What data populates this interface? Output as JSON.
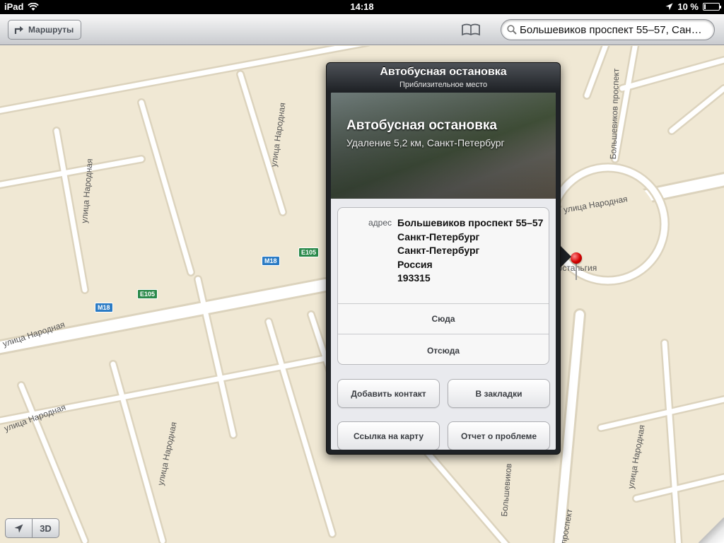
{
  "status_bar": {
    "device": "iPad",
    "time": "14:18",
    "battery": "10 %",
    "battery_level": 0.1
  },
  "toolbar": {
    "routes_label": "Маршруты",
    "bookmarks_icon": "book-icon",
    "search_value": "Большевиков проспект 55–57, Сан…"
  },
  "map": {
    "street_labels": [
      "улица Народная",
      "улица Народная",
      "улица Народная",
      "улица Народная",
      "улица Народная",
      "улица Народная",
      "улица Народная",
      "Большевиков проспект",
      "Большевиков",
      "проспект",
      "Ностальгия"
    ],
    "shields": [
      "M18",
      "E105",
      "M18",
      "E105"
    ]
  },
  "popover": {
    "title": "Автобусная остановка",
    "subtitle": "Приблизительное место",
    "hero_title": "Автобусная остановка",
    "hero_subtitle": "Удаление 5,2 км, Санкт-Петербург",
    "address_label": "адрес",
    "address_lines": [
      "Большевиков проспект 55–57",
      "Санкт-Петербург",
      "Санкт-Петербург",
      "Россия",
      "193315"
    ],
    "directions_here": "Сюда",
    "directions_from": "Отсюда",
    "add_contact": "Добавить контакт",
    "bookmark": "В закладки",
    "share_link": "Ссылка на карту",
    "report_problem": "Отчет о проблеме"
  },
  "bottom_controls": {
    "location_icon": "location-arrow-icon",
    "view_3d": "3D"
  }
}
